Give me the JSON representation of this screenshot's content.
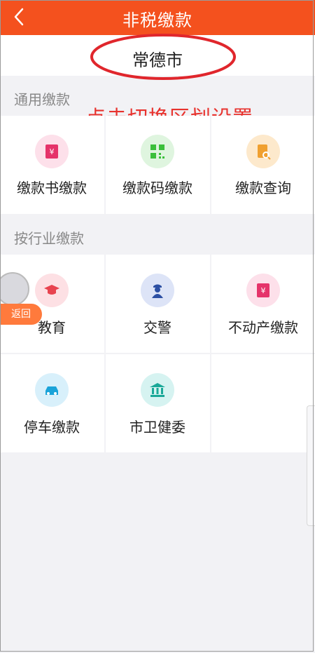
{
  "header": {
    "title": "非税缴款"
  },
  "region": {
    "city": "常德市"
  },
  "hint": "点击切换区划设置",
  "sections": {
    "common": {
      "title": "通用缴款",
      "items": [
        {
          "label": "缴款书缴款"
        },
        {
          "label": "缴款码缴款"
        },
        {
          "label": "缴款查询"
        }
      ]
    },
    "industry": {
      "title": "按行业缴款",
      "items": [
        {
          "label": "教育"
        },
        {
          "label": "交警"
        },
        {
          "label": "不动产缴款"
        },
        {
          "label": "停车缴款"
        },
        {
          "label": "市卫健委"
        }
      ]
    }
  },
  "float_button": {
    "label": "返回"
  },
  "colors": {
    "header": "#f4511e",
    "hint": "#e8332e",
    "annotation": "#e0262c"
  }
}
